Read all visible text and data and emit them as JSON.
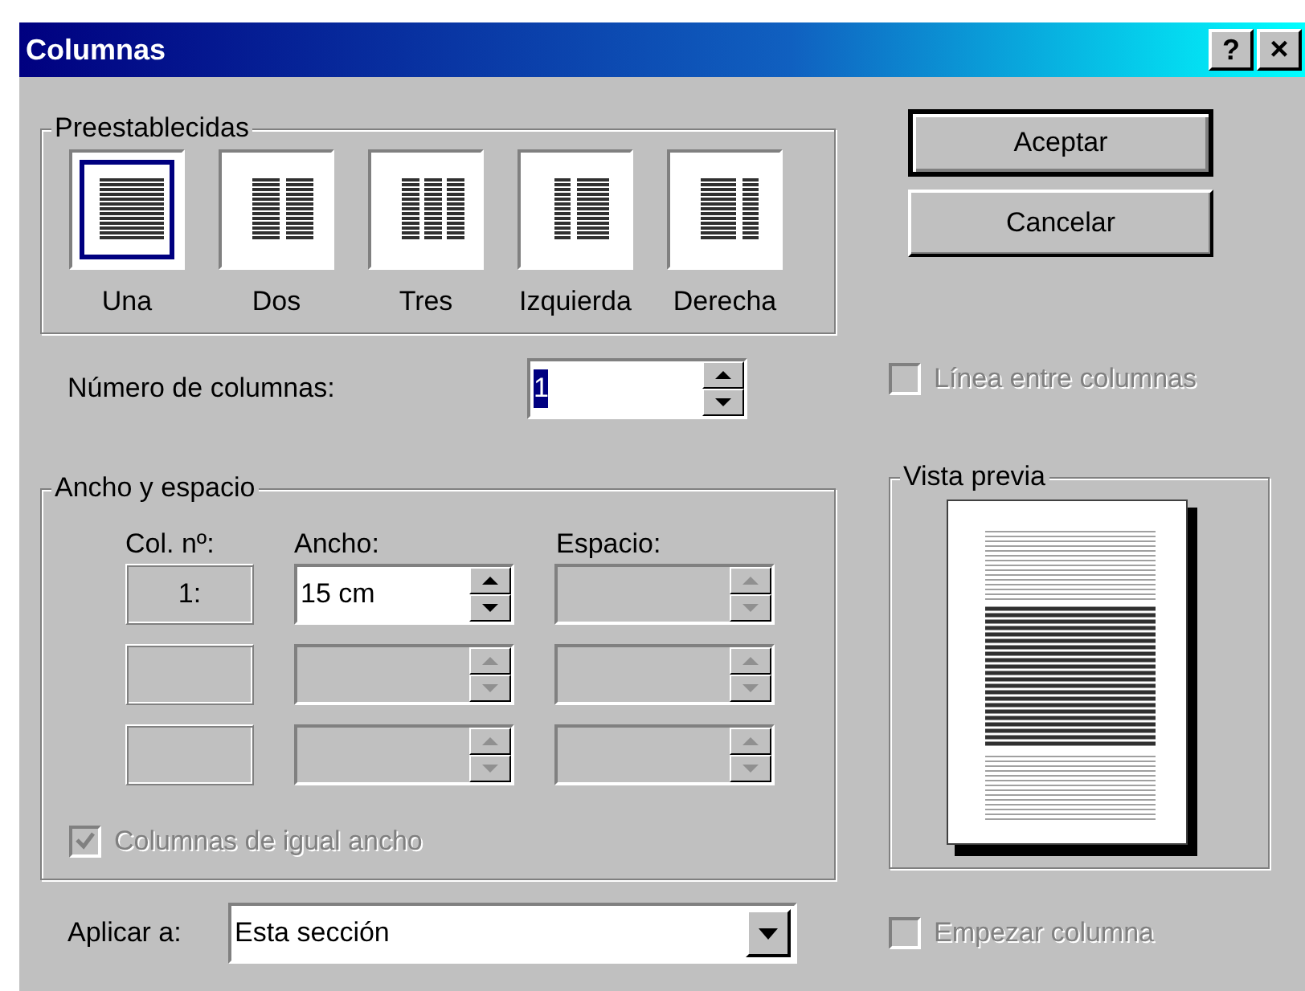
{
  "window": {
    "title": "Columnas",
    "help_button": "?",
    "close_button": "×"
  },
  "presets": {
    "title": "Preestablecidas",
    "items": [
      {
        "label": "Una",
        "kind": "one",
        "selected": true
      },
      {
        "label": "Dos",
        "kind": "two",
        "selected": false
      },
      {
        "label": "Tres",
        "kind": "three",
        "selected": false
      },
      {
        "label": "Izquierda",
        "kind": "left",
        "selected": false
      },
      {
        "label": "Derecha",
        "kind": "right",
        "selected": false
      }
    ]
  },
  "buttons": [
    {
      "label": "Aceptar",
      "default": true
    },
    {
      "label": "Cancelar",
      "default": false
    }
  ],
  "number_of_columns": {
    "label": "Número de columnas:",
    "value": "1",
    "value_selected": true
  },
  "line_between": {
    "label": "Línea entre columnas",
    "checked": false,
    "disabled": true
  },
  "width_spacing": {
    "title": "Ancho y espacio",
    "headers": [
      "Col. nº:",
      "Ancho:",
      "Espacio:"
    ],
    "rows": [
      {
        "col_no": "1:",
        "width": "15 cm",
        "width_disabled": false,
        "spacing_disabled": true
      },
      {
        "width_disabled": true,
        "spacing_disabled": true
      },
      {
        "width_disabled": true,
        "spacing_disabled": true
      }
    ]
  },
  "equal_width": {
    "label": "Columnas de igual ancho",
    "checked": true,
    "disabled": true
  },
  "preview": {
    "title": "Vista previa"
  },
  "apply_to": {
    "label": "Aplicar a:",
    "value": "Esta sección"
  },
  "start_column": {
    "label": "Empezar columna",
    "checked": false,
    "disabled": true
  }
}
